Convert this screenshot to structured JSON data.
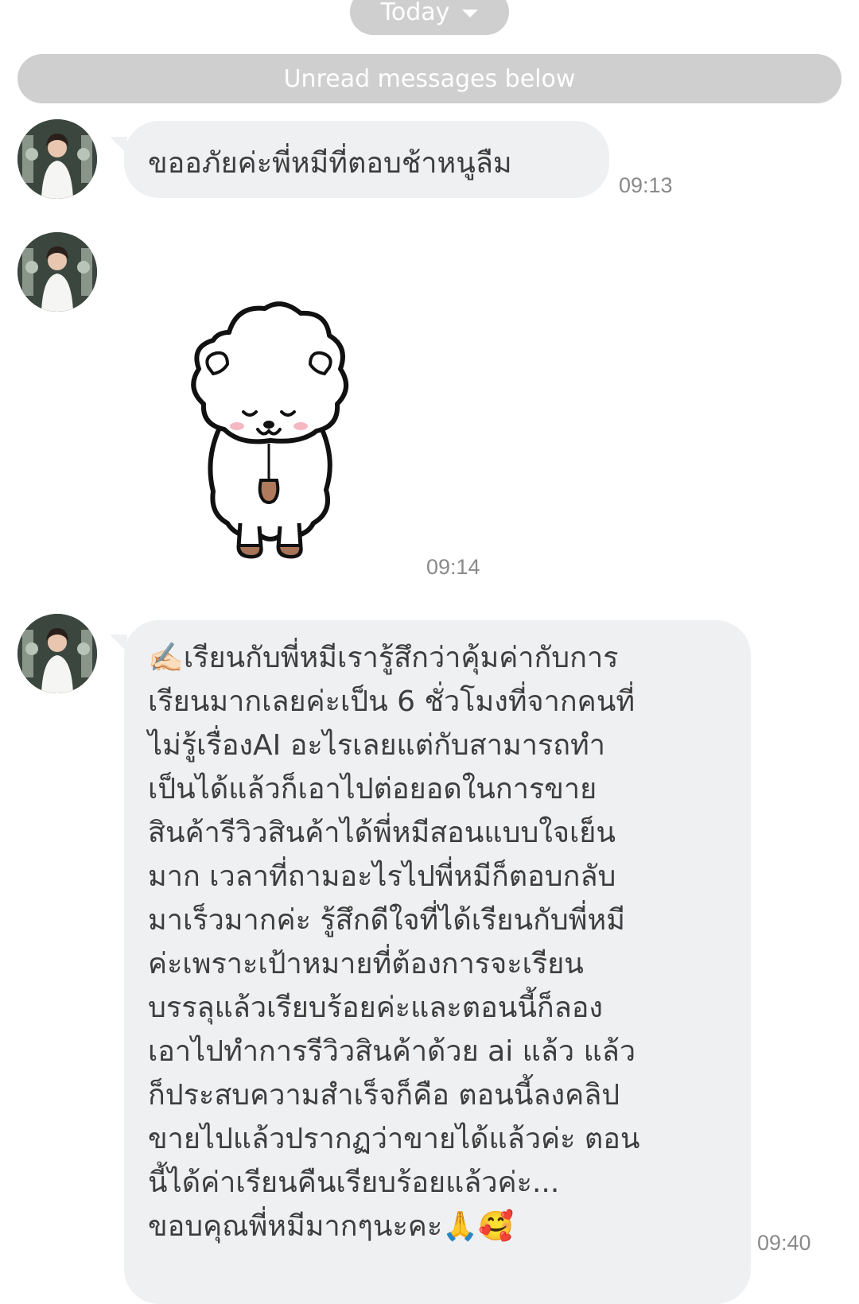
{
  "date_chip": {
    "label": "Today"
  },
  "unread_banner": {
    "label": "Unread messages below"
  },
  "messages": [
    {
      "type": "text",
      "text": "ขออภัยค่ะพี่หมีที่ตอบช้าหนูลืม",
      "time": "09:13"
    },
    {
      "type": "sticker",
      "sticker": "bowing-sheep-bear-sticker",
      "time": "09:14"
    },
    {
      "type": "text",
      "prefix_icon": "writing-hand-emoji",
      "lines": [
        "✍🏻เรียนกับพี่หมีเรารู้สึกว่าคุ้มค่ากับการ",
        "เรียนมากเลยค่ะเป็น 6 ชั่วโมงที่จากคนที่",
        "ไม่รู้เรื่องAI อะไรเลยแต่กับสามารถทำ",
        "เป็นได้แล้วก็เอาไปต่อยอดในการขาย",
        "สินค้ารีวิวสินค้าได้พี่หมีสอนแบบใจเย็น",
        "มาก เวลาที่ถามอะไรไปพี่หมีก็ตอบกลับ",
        "มาเร็วมากค่ะ รู้สึกดีใจที่ได้เรียนกับพี่หมี",
        "ค่ะเพราะเป้าหมายที่ต้องการจะเรียน",
        "บรรลุแล้วเรียบร้อยค่ะและตอนนี้ก็ลอง",
        "เอาไปทำการรีวิวสินค้าด้วย ai แล้ว แล้ว",
        "ก็ประสบความสำเร็จก็คือ ตอนนี้ลงคลิป",
        "ขายไปแล้วปรากฏว่าขายได้แล้วค่ะ ตอน",
        "นี้ได้ค่าเรียนคืนเรียบร้อยแล้วค่ะ...",
        "ขอบคุณพี่หมีมากๆนะคะ🙏🥰"
      ],
      "time": "09:40"
    }
  ],
  "colors": {
    "chip_bg": "#cfcfcf",
    "bubble_bg": "#eff0f2",
    "text": "#3d3d3d",
    "timestamp": "#8a8a8a"
  }
}
